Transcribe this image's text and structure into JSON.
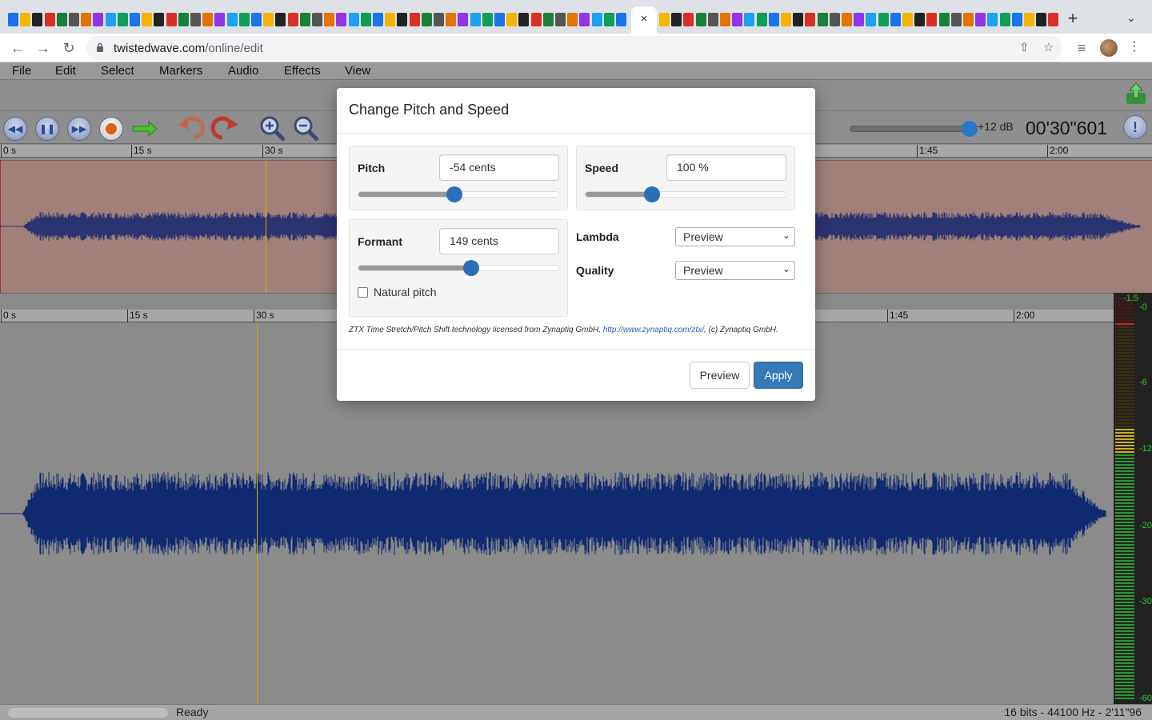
{
  "browser": {
    "active_tab_close": "×",
    "new_tab": "+",
    "tab_search": "⌄",
    "url_host": "twistedwave.com",
    "url_path": "/online/edit",
    "tab_favicon_colors": [
      "#1a73e8",
      "#f4b400",
      "#222",
      "#d93025",
      "#188038",
      "#555",
      "#e37400",
      "#9334e6",
      "#1da1f2",
      "#0f9d58"
    ]
  },
  "menu": [
    "File",
    "Edit",
    "Select",
    "Markers",
    "Audio",
    "Effects",
    "View"
  ],
  "transport": {
    "volume_label": "+12 dB",
    "volume_level": 0.95,
    "time": "00'30\"601",
    "info": "!"
  },
  "rulers": {
    "overview_ticks": [
      "0 s",
      "15 s",
      "30 s",
      "1:45",
      "2:00"
    ],
    "main_ticks": [
      "0 s",
      "15 s",
      "30 s",
      "1:45",
      "2:00"
    ]
  },
  "meter": {
    "labels": [
      "-1.5",
      "-0",
      "-6",
      "-12",
      "-20",
      "-30",
      "-60"
    ]
  },
  "status": {
    "text": "Ready",
    "format": "16 bits - 44100 Hz - 2'11\"96"
  },
  "dialog": {
    "title": "Change Pitch and Speed",
    "pitch": {
      "label": "Pitch",
      "value": "-54 cents",
      "slider": 0.48
    },
    "speed": {
      "label": "Speed",
      "value": "100 %",
      "slider": 0.33
    },
    "formant": {
      "label": "Formant",
      "value": "149 cents",
      "slider": 0.565
    },
    "natural_pitch": {
      "label": "Natural pitch",
      "checked": false
    },
    "lambda": {
      "label": "Lambda",
      "value": "Preview"
    },
    "quality": {
      "label": "Quality",
      "value": "Preview"
    },
    "credit": {
      "prefix": "ZTX Time Stretch/Pitch Shift technology licensed from Zynaptiq GmbH, ",
      "link": "http://www.zynaptiq.com/ztx/",
      "suffix": ", (c) Zynaptiq GmbH."
    },
    "buttons": {
      "preview": "Preview",
      "apply": "Apply"
    }
  }
}
